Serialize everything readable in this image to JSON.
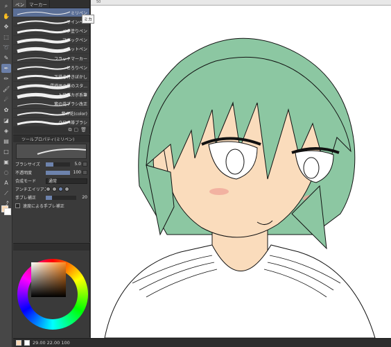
{
  "tools": [
    "magnifier",
    "hand",
    "move",
    "select",
    "lasso",
    "eyedrop",
    "pen",
    "pencil",
    "brush",
    "airbrush",
    "deco",
    "eraser",
    "fill",
    "gradient",
    "figure",
    "frame",
    "balloon",
    "text",
    "ruler",
    "correct"
  ],
  "subtool": {
    "tabs": [
      "ペン",
      "マーカー"
    ],
    "brushes": [
      {
        "name": "ミリペン"
      },
      {
        "name": "サインペン"
      },
      {
        "name": "ベタ塗りペン"
      },
      {
        "name": "マジックペン"
      },
      {
        "name": "ドットペン"
      },
      {
        "name": "フラットマーカー"
      },
      {
        "name": "とろりペン"
      },
      {
        "name": "下描き付きぼかし"
      },
      {
        "name": "雲描画の星のスタ..."
      },
      {
        "name": "トロピカボ系筆"
      },
      {
        "name": "紫の花ブラシ改正"
      },
      {
        "name": "紫の花(color)"
      },
      {
        "name": "クロベ帯ブラシ"
      }
    ],
    "selected_index": 0
  },
  "tooltip": "ミカ",
  "tool_property": {
    "header": "ツールプロパティ(ミリペン)",
    "brush_size_label": "ブラシサイズ",
    "brush_size_value": "5.0",
    "opacity_label": "不透明度",
    "opacity_value": "100",
    "blend_label": "合成モード",
    "blend_value": "通常",
    "aa_label": "アンチエイリアス",
    "stabilize_label": "手ブレ補正",
    "stabilize_value": "20",
    "speed_label": "速度による手ブレ補正"
  },
  "status": {
    "text": "29.00 22.00 100"
  },
  "colors": {
    "hair": "#8cc7a2",
    "skin": "#fadcbc",
    "blush": "#f0a89a",
    "fg_swatch": "#f9d9b6",
    "accent": "#6b7fa8"
  },
  "ruler_label": "50"
}
